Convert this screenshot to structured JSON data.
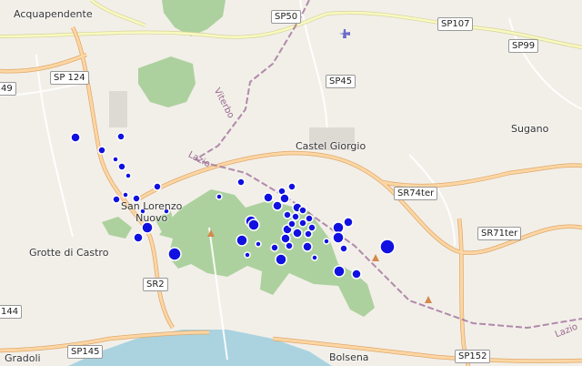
{
  "map": {
    "places": [
      {
        "id": "acquapendente",
        "label": "Acquapendente"
      },
      {
        "id": "castel-giorgio",
        "label": "Castel Giorgio"
      },
      {
        "id": "sugano",
        "label": "Sugano"
      },
      {
        "id": "san-lorenzo",
        "label": "San Lorenzo\nNuovo"
      },
      {
        "id": "grotte",
        "label": "Grotte di Castro"
      },
      {
        "id": "gradoli",
        "label": "Gradoli"
      },
      {
        "id": "bolsena",
        "label": "Bolsena"
      }
    ],
    "roads": [
      {
        "id": "sp50",
        "label": "SP50"
      },
      {
        "id": "sp107",
        "label": "SP107"
      },
      {
        "id": "sp99",
        "label": "SP99"
      },
      {
        "id": "sp124",
        "label": "SP 124"
      },
      {
        "id": "sp45",
        "label": "SP45"
      },
      {
        "id": "sr74ter",
        "label": "SR74ter"
      },
      {
        "id": "sr71ter",
        "label": "SR71ter"
      },
      {
        "id": "sr2",
        "label": "SR2"
      },
      {
        "id": "sp145",
        "label": "SP145"
      },
      {
        "id": "sp152",
        "label": "SP152"
      },
      {
        "id": "left-49",
        "label": "49"
      },
      {
        "id": "left-144",
        "label": "144"
      }
    ],
    "regions": [
      {
        "id": "viterbo",
        "label": "Viterbo"
      },
      {
        "id": "lazio-1",
        "label": "Lazio"
      },
      {
        "id": "lazio-2",
        "label": "Lazio"
      }
    ],
    "colors": {
      "land": "#f2efe9",
      "forest": "#add19e",
      "water": "#aad3df",
      "primary_road": "#fcd6a4",
      "secondary_road": "#f7fabf",
      "boundary": "#a0709a",
      "marker_fill": "#1010e0",
      "marker_stroke": "#ffffff"
    },
    "icons": [
      "airport-icon",
      "peak-icon"
    ]
  }
}
